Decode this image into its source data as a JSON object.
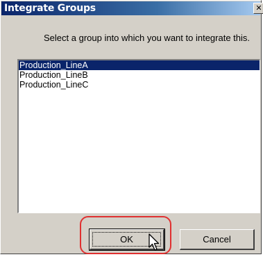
{
  "window": {
    "title": "Integrate Groups",
    "close_glyph": "✕",
    "close_icon": "close-icon"
  },
  "prompt": "Select a group into which you want to integrate this.",
  "groups": {
    "items": [
      "Production_LineA",
      "Production_LineB",
      "Production_LineC"
    ],
    "selected": "Production_LineA"
  },
  "buttons": {
    "ok": "OK",
    "cancel": "Cancel"
  },
  "colors": {
    "title_bar": "#0a246a",
    "selection": "#0a246a",
    "highlight": "#e03030",
    "dialog_face": "#d4d0c8"
  },
  "cursor_icon": "mouse-pointer-icon"
}
